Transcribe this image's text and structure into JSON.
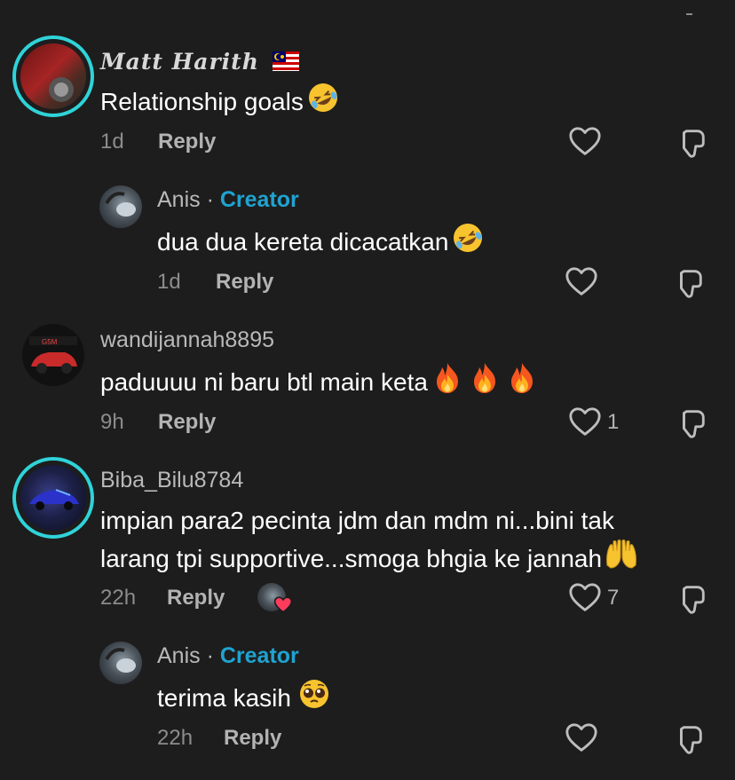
{
  "comments": [
    {
      "name": "Matt Harith",
      "text": "Relationship goals",
      "time": "1d",
      "reply": "Reply",
      "likes": ""
    },
    {
      "name": "Anis",
      "dot": "·",
      "badge": "Creator",
      "text": "dua dua kereta dicacatkan",
      "time": "1d",
      "reply": "Reply",
      "likes": ""
    },
    {
      "name": "wandijannah8895",
      "text": "paduuuu ni baru btl main keta",
      "time": "9h",
      "reply": "Reply",
      "likes": "1"
    },
    {
      "name": "Biba_Bilu8784",
      "text_line1": "impian para2 pecinta jdm dan mdm ni...bini tak",
      "text_line2": "larang tpi supportive...smoga bhgia ke jannah",
      "time": "22h",
      "reply": "Reply",
      "likes": "7"
    },
    {
      "name": "Anis",
      "dot": "·",
      "badge": "Creator",
      "text": "terima kasih",
      "time": "22h",
      "reply": "Reply",
      "likes": ""
    }
  ],
  "icons": {
    "like": "heart-outline-icon",
    "dislike": "thumbs-down-outline-icon",
    "laughing": "rolling-laughing-emoji",
    "fire": "fire-emoji",
    "hands": "raising-hands-emoji",
    "pleading": "pleading-face-emoji",
    "flag": "malaysia-flag"
  },
  "colors": {
    "background": "#1d1d1d",
    "creator": "#1fa3d0",
    "ring": "#2fd3d8",
    "liked": "#ff3b5c"
  }
}
